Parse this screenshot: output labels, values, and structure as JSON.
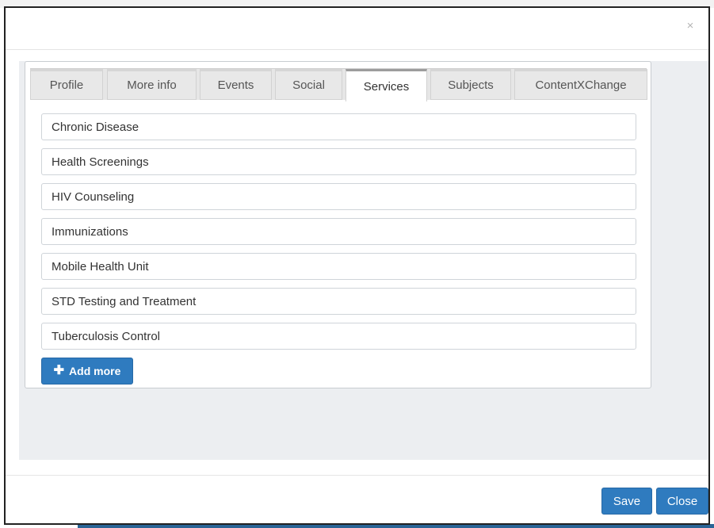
{
  "dialog": {
    "close_glyph": "×"
  },
  "tabs": [
    {
      "label": "Profile",
      "active": false
    },
    {
      "label": "More info",
      "active": false
    },
    {
      "label": "Events",
      "active": false
    },
    {
      "label": "Social",
      "active": false
    },
    {
      "label": "Services",
      "active": true
    },
    {
      "label": "Subjects",
      "active": false
    },
    {
      "label": "ContentXChange",
      "active": false
    }
  ],
  "services": {
    "items": [
      "Chronic Disease",
      "Health Screenings",
      "HIV Counseling",
      "Immunizations",
      "Mobile Health Unit",
      "STD Testing and Treatment",
      "Tuberculosis Control"
    ],
    "add_more_label": "Add more",
    "add_more_icon": "plus-icon"
  },
  "footer": {
    "save_label": "Save",
    "close_label": "Close"
  },
  "colors": {
    "primary_button": "#2f7bbf",
    "body_background": "#eceef1",
    "accent_bar": "#2a6496"
  }
}
